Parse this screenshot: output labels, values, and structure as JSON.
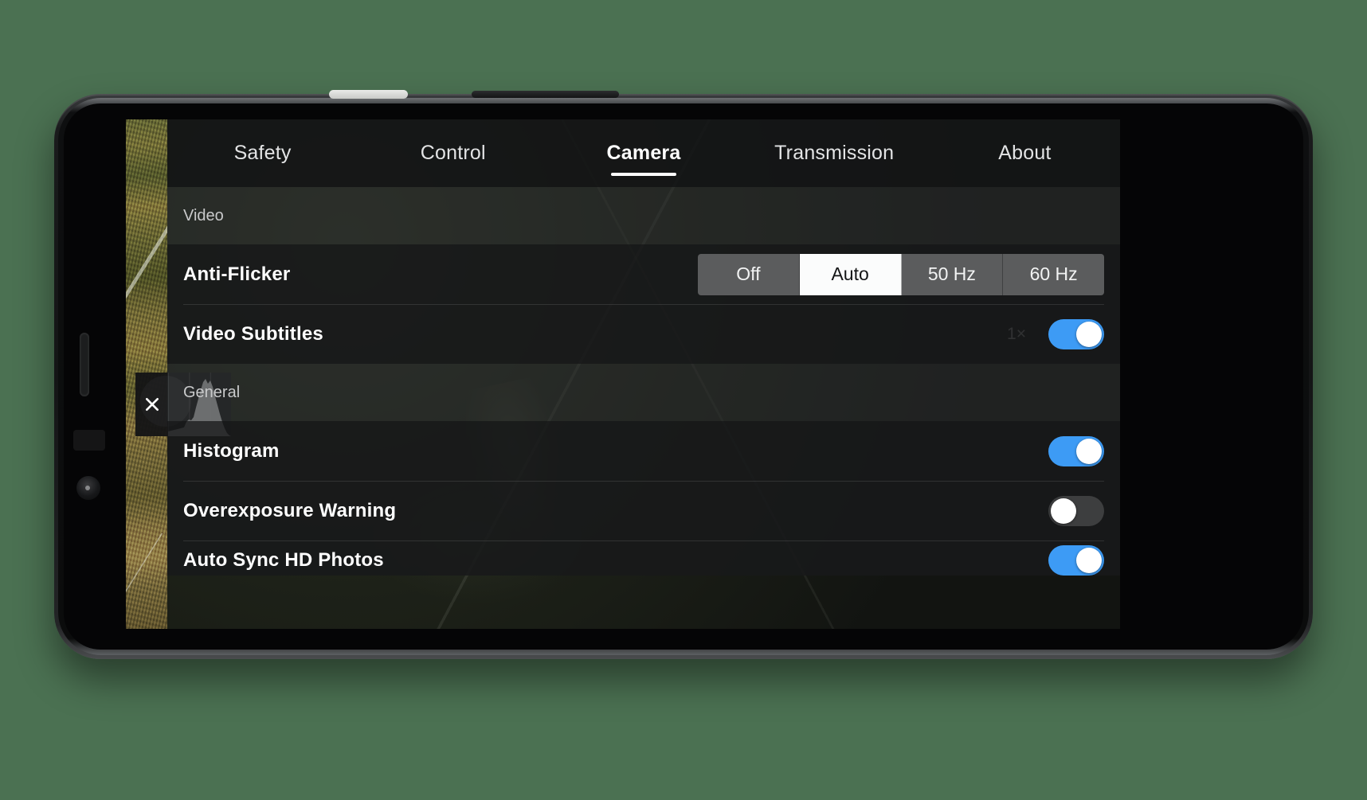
{
  "app": {
    "background_color": "#4b7152",
    "accent_color": "#3d9bf5",
    "panel_bg": "#181a1b"
  },
  "tabs": [
    {
      "label": "Safety",
      "active": false
    },
    {
      "label": "Control",
      "active": false
    },
    {
      "label": "Camera",
      "active": true
    },
    {
      "label": "Transmission",
      "active": false
    },
    {
      "label": "About",
      "active": false
    }
  ],
  "sections": [
    {
      "title": "Video",
      "rows": [
        {
          "label": "Anti-Flicker",
          "control": "segmented",
          "options": [
            "Off",
            "Auto",
            "50 Hz",
            "60 Hz"
          ],
          "selected": "Auto"
        },
        {
          "label": "Video Subtitles",
          "control": "toggle",
          "value": "on",
          "watermark": "1×"
        }
      ]
    },
    {
      "title": "General",
      "rows": [
        {
          "label": "Histogram",
          "control": "toggle",
          "value": "on"
        },
        {
          "label": "Overexposure Warning",
          "control": "toggle",
          "value": "off"
        },
        {
          "label": "Auto Sync HD Photos",
          "control": "toggle",
          "value": "on"
        }
      ]
    }
  ],
  "histogram_widget": {
    "close_icon": "close-icon",
    "visible": true
  }
}
